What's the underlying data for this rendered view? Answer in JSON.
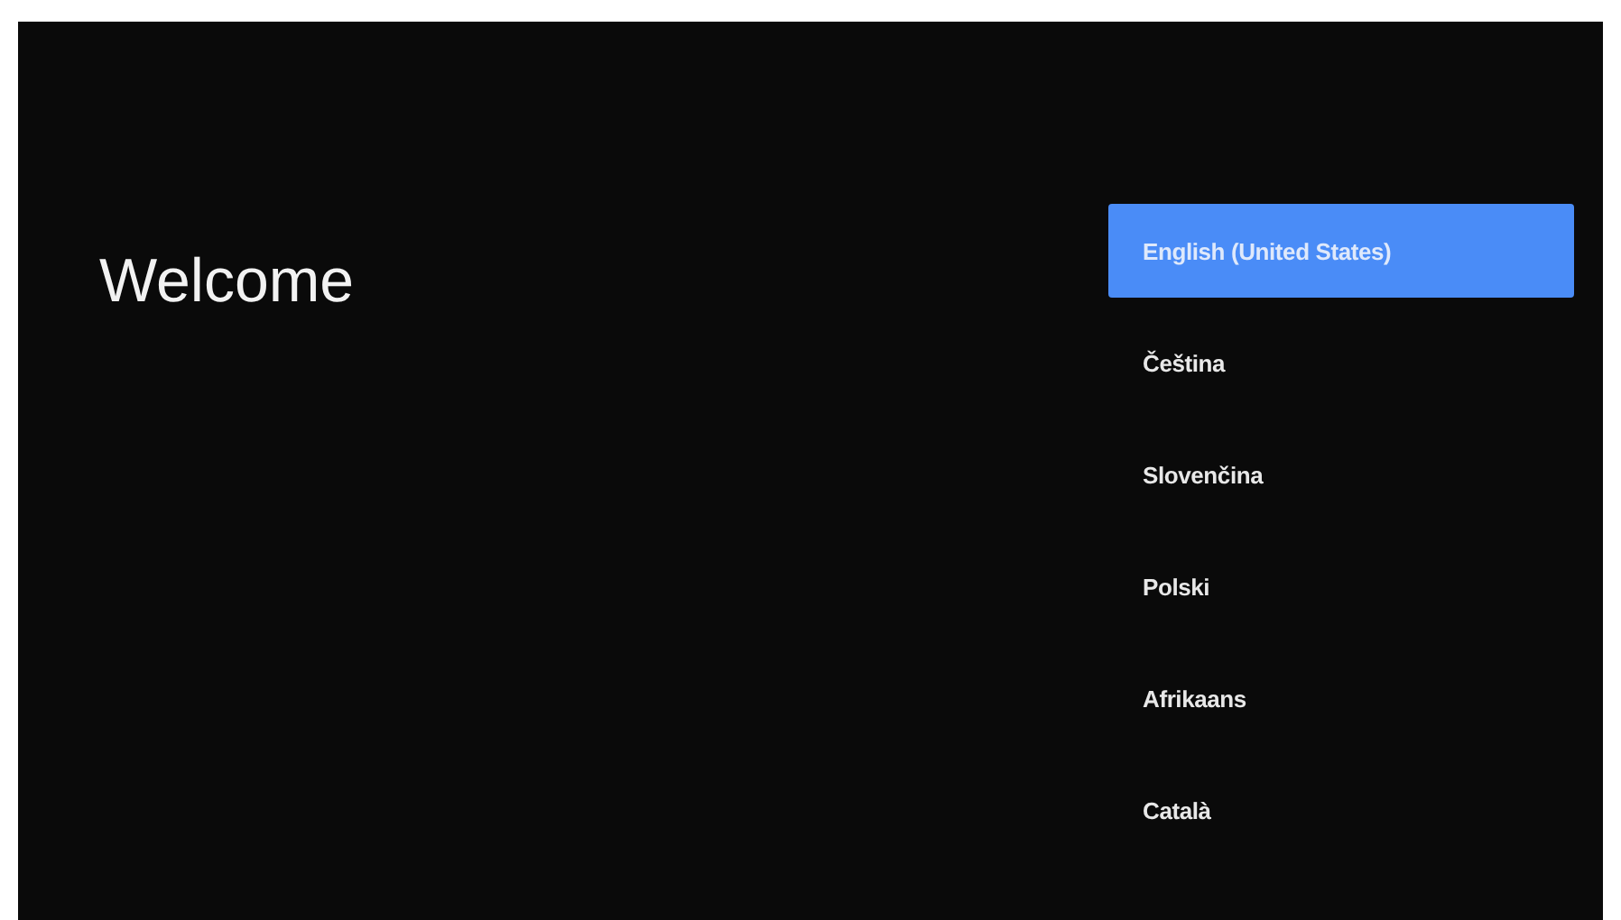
{
  "title": "Welcome",
  "languages": [
    {
      "label": "English (United States)",
      "selected": true
    },
    {
      "label": "Čeština",
      "selected": false
    },
    {
      "label": "Slovenčina",
      "selected": false
    },
    {
      "label": "Polski",
      "selected": false
    },
    {
      "label": "Afrikaans",
      "selected": false
    },
    {
      "label": "Català",
      "selected": false
    }
  ]
}
